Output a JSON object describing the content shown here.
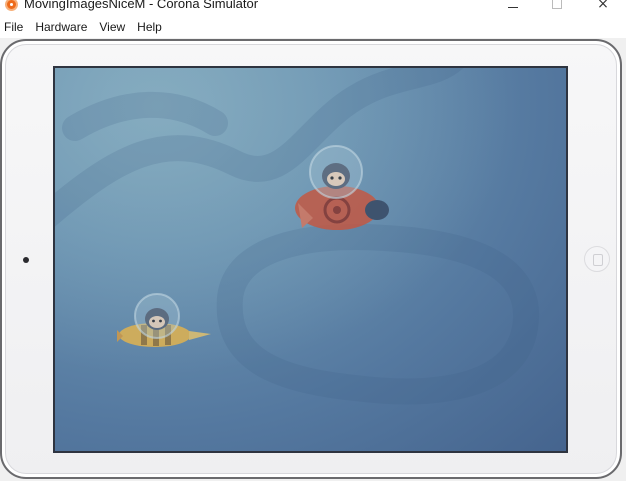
{
  "window": {
    "title": "MovingImagesNiceM - Corona Simulator",
    "app_icon": "corona-icon",
    "controls": {
      "minimize": "minimize-icon",
      "maximize": "maximize-icon",
      "close": "×"
    }
  },
  "menu": {
    "items": [
      {
        "label": "File"
      },
      {
        "label": "Hardware"
      },
      {
        "label": "View"
      },
      {
        "label": "Help"
      }
    ]
  },
  "device": {
    "model_icon": "ipad-frame",
    "colors": {
      "bezel": "#f2f2f4",
      "outline": "#6a6a6d",
      "screen_top": "#7da3b8",
      "screen_bottom": "#45648e"
    }
  },
  "scene": {
    "sprites": [
      {
        "name": "astronaut-in-red-fish-ship"
      },
      {
        "name": "astronaut-in-yellow-bee-ship"
      }
    ]
  }
}
